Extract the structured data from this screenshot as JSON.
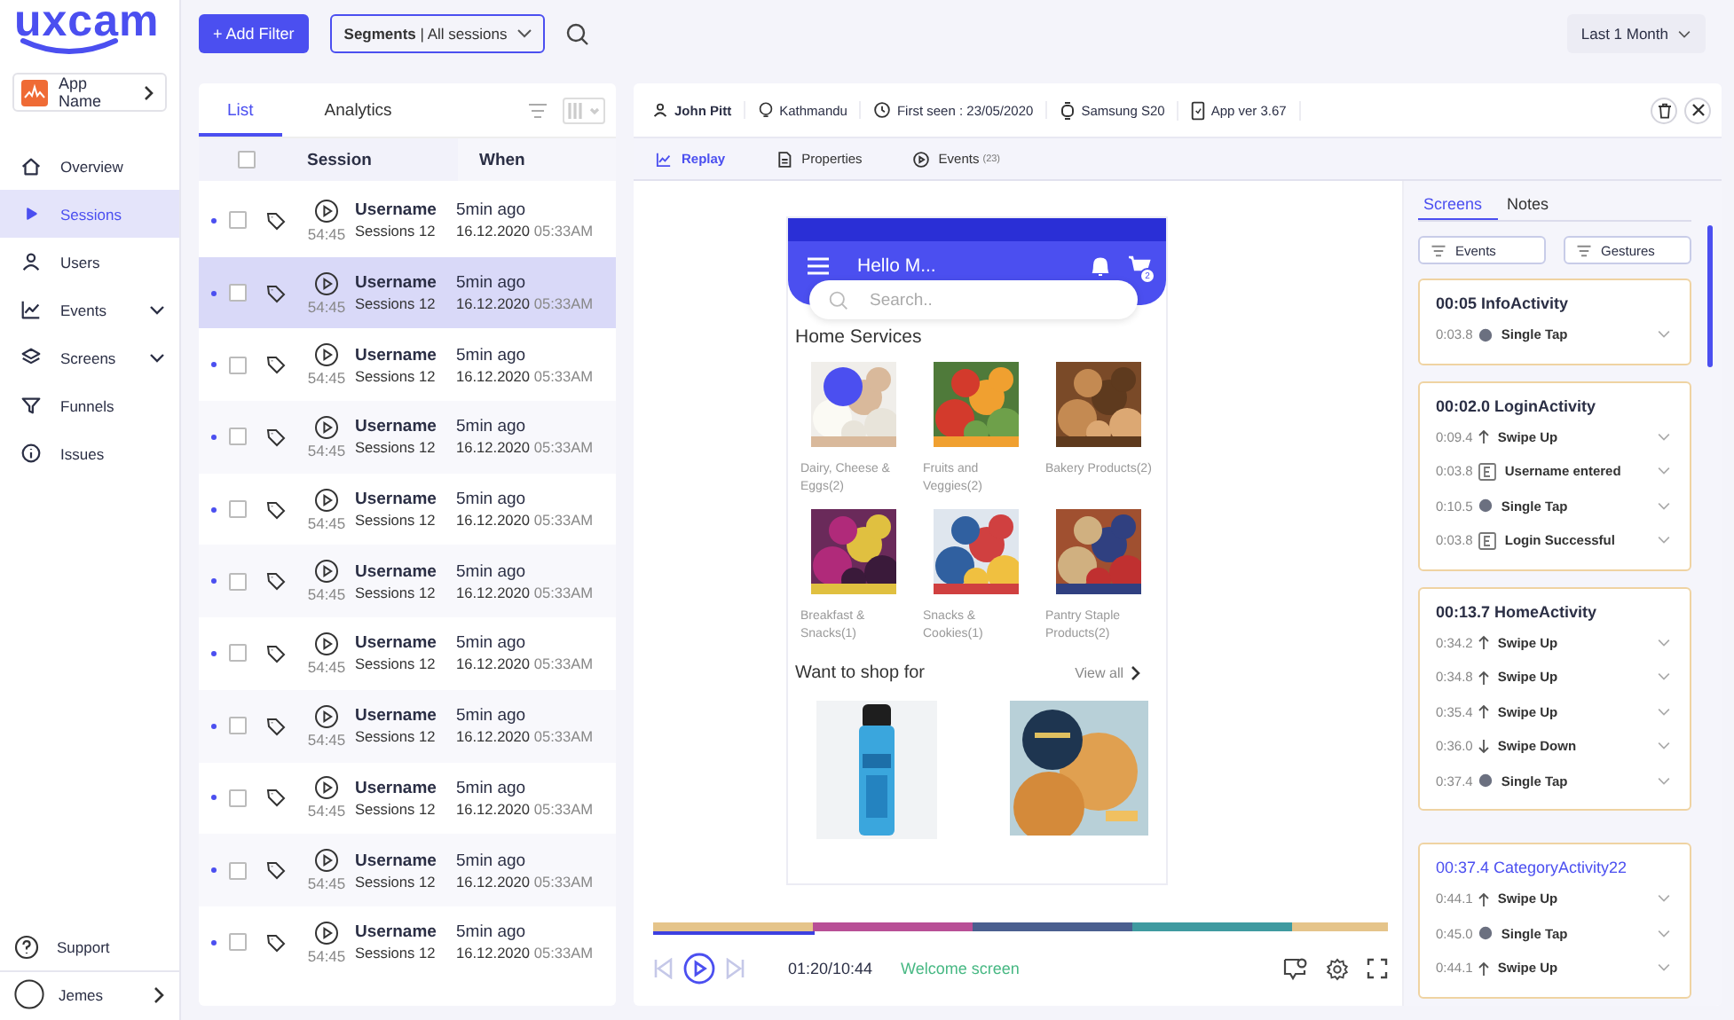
{
  "brand": {
    "logo": "uxcam"
  },
  "app_switcher": {
    "label": "App Name"
  },
  "sidebar": {
    "items": [
      {
        "label": "Overview",
        "selected": false,
        "expandable": false
      },
      {
        "label": "Sessions",
        "selected": true,
        "expandable": false
      },
      {
        "label": "Users",
        "selected": false,
        "expandable": false
      },
      {
        "label": "Events",
        "selected": false,
        "expandable": true
      },
      {
        "label": "Screens",
        "selected": false,
        "expandable": true
      },
      {
        "label": "Funnels",
        "selected": false,
        "expandable": false
      },
      {
        "label": "Issues",
        "selected": false,
        "expandable": false
      }
    ],
    "support": "Support",
    "user": "Jemes"
  },
  "toolbar": {
    "add_filter": "+ Add Filter",
    "segments": "**Segments** | All sessions",
    "period": "Last 1 Month"
  },
  "session_list": {
    "tabs": [
      {
        "label": "List",
        "selected": true
      },
      {
        "label": "Analytics",
        "selected": false
      }
    ],
    "select_all_checked": false,
    "columns": [
      "Session",
      "When"
    ],
    "rows": [
      {
        "unread": true,
        "checked": false,
        "selected": false,
        "duration": "54:45",
        "user": "Username",
        "sessions": "Sessions 12",
        "ago": "5min ago",
        "date": "16.12.2020",
        "time": "05:33AM"
      },
      {
        "unread": true,
        "checked": false,
        "selected": true,
        "duration": "54:45",
        "user": "Username",
        "sessions": "Sessions 12",
        "ago": "5min ago",
        "date": "16.12.2020",
        "time": "05:33AM"
      },
      {
        "unread": true,
        "checked": false,
        "selected": false,
        "duration": "54:45",
        "user": "Username",
        "sessions": "Sessions 12",
        "ago": "5min ago",
        "date": "16.12.2020",
        "time": "05:33AM"
      },
      {
        "unread": true,
        "checked": false,
        "selected": false,
        "duration": "54:45",
        "user": "Username",
        "sessions": "Sessions 12",
        "ago": "5min ago",
        "date": "16.12.2020",
        "time": "05:33AM"
      },
      {
        "unread": true,
        "checked": false,
        "selected": false,
        "duration": "54:45",
        "user": "Username",
        "sessions": "Sessions 12",
        "ago": "5min ago",
        "date": "16.12.2020",
        "time": "05:33AM"
      },
      {
        "unread": true,
        "checked": false,
        "selected": false,
        "duration": "54:45",
        "user": "Username",
        "sessions": "Sessions 12",
        "ago": "5min ago",
        "date": "16.12.2020",
        "time": "05:33AM"
      },
      {
        "unread": true,
        "checked": false,
        "selected": false,
        "duration": "54:45",
        "user": "Username",
        "sessions": "Sessions 12",
        "ago": "5min ago",
        "date": "16.12.2020",
        "time": "05:33AM"
      },
      {
        "unread": true,
        "checked": false,
        "selected": false,
        "duration": "54:45",
        "user": "Username",
        "sessions": "Sessions 12",
        "ago": "5min ago",
        "date": "16.12.2020",
        "time": "05:33AM"
      },
      {
        "unread": true,
        "checked": false,
        "selected": false,
        "duration": "54:45",
        "user": "Username",
        "sessions": "Sessions 12",
        "ago": "5min ago",
        "date": "16.12.2020",
        "time": "05:33AM"
      },
      {
        "unread": true,
        "checked": false,
        "selected": false,
        "duration": "54:45",
        "user": "Username",
        "sessions": "Sessions 12",
        "ago": "5min ago",
        "date": "16.12.2020",
        "time": "05:33AM"
      },
      {
        "unread": true,
        "checked": false,
        "selected": false,
        "duration": "54:45",
        "user": "Username",
        "sessions": "Sessions 12",
        "ago": "5min ago",
        "date": "16.12.2020",
        "time": "05:33AM"
      }
    ]
  },
  "session_header": {
    "user": "John Pitt",
    "location": "Kathmandu",
    "first_seen": "First seen : 23/05/2020",
    "device": "Samsung S20",
    "app_version": "App ver 3.67"
  },
  "detail_tabs": [
    {
      "label": "Replay",
      "selected": true
    },
    {
      "label": "Properties",
      "selected": false
    },
    {
      "label": "Events",
      "count": "(23)",
      "selected": false
    }
  ],
  "phone": {
    "title": "Hello M...",
    "cart_count": "2",
    "search_placeholder": "Search..",
    "section": "Home Services",
    "categories": [
      {
        "label": "Dairy, Cheese & Eggs(2)"
      },
      {
        "label": "Fruits and Veggies(2)"
      },
      {
        "label": "Bakery Products(2)"
      },
      {
        "label": "Breakfast & Snacks(1)"
      },
      {
        "label": "Snacks & Cookies(1)"
      },
      {
        "label": "Pantry Staple Products(2)"
      }
    ],
    "shop_heading": "Want to shop for",
    "view_all": "View all"
  },
  "player": {
    "level": 0.22,
    "segments": [
      {
        "color": "#e5c48a"
      },
      {
        "color": "#b84f96"
      },
      {
        "color": "#4a5f8f"
      },
      {
        "color": "#3f9aa0"
      },
      {
        "color": "#e5c48a"
      }
    ],
    "time": "01:20/10:44",
    "screen_label": "Welcome screen"
  },
  "screens_panel": {
    "tabs": [
      {
        "label": "Screens",
        "selected": true
      },
      {
        "label": "Notes",
        "selected": false
      }
    ],
    "filters": [
      "Events",
      "Gestures"
    ],
    "cards": [
      {
        "title": "00:05 InfoActivity",
        "active": false,
        "events": [
          {
            "time": "0:03.8",
            "kind": "tap",
            "label": "Single Tap"
          }
        ]
      },
      {
        "title": "00:02.0 LoginActivity",
        "active": false,
        "events": [
          {
            "time": "0:09.4",
            "kind": "swipe-up",
            "label": "Swipe Up"
          },
          {
            "time": "0:03.8",
            "kind": "event",
            "label": "Username entered"
          },
          {
            "time": "0:10.5",
            "kind": "tap",
            "label": "Single Tap"
          },
          {
            "time": "0:03.8",
            "kind": "event",
            "label": "Login Successful"
          }
        ]
      },
      {
        "title": "00:13.7 HomeActivity",
        "active": false,
        "events": [
          {
            "time": "0:34.2",
            "kind": "swipe-up",
            "label": "Swipe Up"
          },
          {
            "time": "0:34.8",
            "kind": "swipe-up",
            "label": "Swipe Up"
          },
          {
            "time": "0:35.4",
            "kind": "swipe-up",
            "label": "Swipe Up"
          },
          {
            "time": "0:36.0",
            "kind": "swipe-down",
            "label": "Swipe Down"
          },
          {
            "time": "0:37.4",
            "kind": "tap",
            "label": "Single Tap"
          }
        ]
      },
      {
        "title": "00:37.4 CategoryActivity22",
        "active": true,
        "events": [
          {
            "time": "0:44.1",
            "kind": "swipe-up",
            "label": "Swipe Up"
          },
          {
            "time": "0:45.0",
            "kind": "tap",
            "label": "Single Tap"
          },
          {
            "time": "0:44.1",
            "kind": "swipe-up",
            "label": "Swipe Up"
          }
        ]
      }
    ]
  }
}
